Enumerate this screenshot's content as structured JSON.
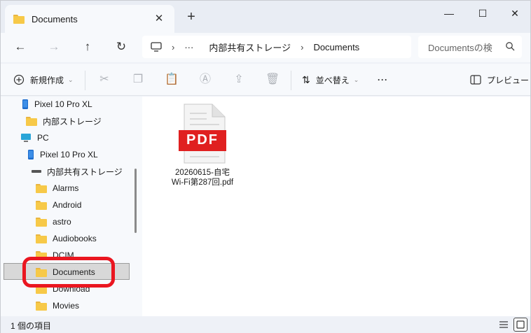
{
  "window": {
    "tab_title": "Documents",
    "tab_close": "✕",
    "new_tab": "+",
    "minimize": "—",
    "maximize": "☐",
    "close": "✕"
  },
  "nav": {
    "back": "←",
    "forward": "→",
    "up": "↑",
    "refresh": "↻"
  },
  "address": {
    "more": "···",
    "breadcrumbs": [
      "内部共有ストレージ",
      "Documents"
    ],
    "separator": "›"
  },
  "search": {
    "placeholder": "Documentsの検"
  },
  "toolbar": {
    "new_label": "新規作成",
    "sort_label": "並べ替え",
    "more_label": "···",
    "preview_label": "プレビュー"
  },
  "sidebar": {
    "items": [
      {
        "label": "Pixel 10 Pro XL",
        "icon": "phone-icon"
      },
      {
        "label": "内部ストレージ",
        "icon": "folder-icon"
      },
      {
        "label": "PC",
        "icon": "monitor-icon"
      },
      {
        "label": "Pixel 10 Pro XL",
        "icon": "phone-icon"
      },
      {
        "label": "内部共有ストレージ",
        "icon": "drive-icon"
      },
      {
        "label": "Alarms",
        "icon": "folder-icon"
      },
      {
        "label": "Android",
        "icon": "folder-icon"
      },
      {
        "label": "astro",
        "icon": "folder-icon"
      },
      {
        "label": "Audiobooks",
        "icon": "folder-icon"
      },
      {
        "label": "DCIM",
        "icon": "folder-icon"
      },
      {
        "label": "Documents",
        "icon": "folder-icon",
        "selected": true
      },
      {
        "label": "Download",
        "icon": "folder-icon"
      },
      {
        "label": "Movies",
        "icon": "folder-icon"
      }
    ]
  },
  "files": [
    {
      "name_line1": "20260615-自宅",
      "name_line2": "Wi-Fi第287回.pdf",
      "icon_text": "PDF",
      "icon": "pdf-file-icon"
    }
  ],
  "status": {
    "count": "1 個の項目"
  },
  "colors": {
    "highlight": "#ea1620",
    "pdf_red": "#e02020",
    "folder": "#f7c948",
    "selected_bg": "#d8d8d8"
  }
}
